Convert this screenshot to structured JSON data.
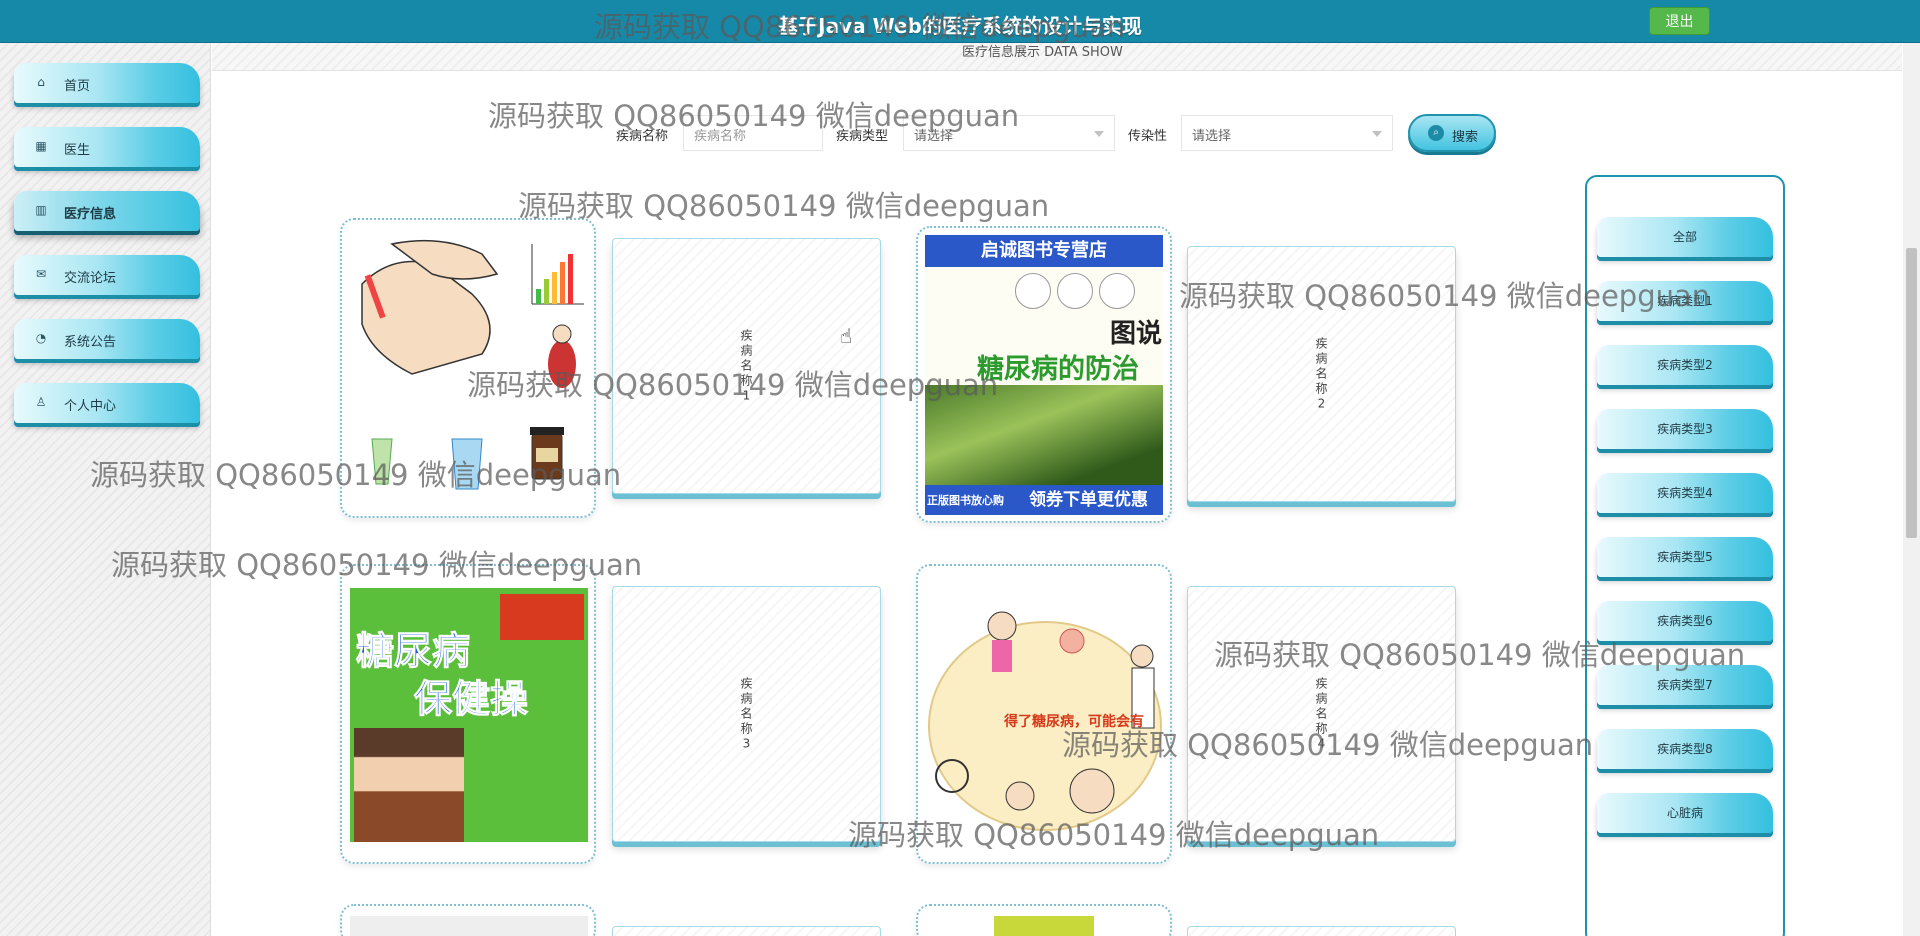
{
  "header": {
    "title": "基于Java Web的医疗系统的设计与实现",
    "logout_label": "退出"
  },
  "sidebar": {
    "items": [
      {
        "label": "首页",
        "icon": "home-icon"
      },
      {
        "label": "医生",
        "icon": "calendar-icon"
      },
      {
        "label": "医疗信息",
        "icon": "book-icon",
        "active": true
      },
      {
        "label": "交流论坛",
        "icon": "mail-icon"
      },
      {
        "label": "系统公告",
        "icon": "palette-icon"
      },
      {
        "label": "个人中心",
        "icon": "user-icon"
      }
    ]
  },
  "page": {
    "subtitle": "医疗信息展示 DATA SHOW"
  },
  "search": {
    "name_label": "疾病名称",
    "name_placeholder": "疾病名称",
    "type_label": "疾病类型",
    "type_value": "请选择",
    "infectious_label": "传染性",
    "infectious_value": "请选择",
    "button_label": "搜索"
  },
  "cards": {
    "c1": {
      "image": "diabetes-test-illustration"
    },
    "c2": {
      "label": "疾病名称1"
    },
    "c3": {
      "image": "diabetes-book-cover",
      "banner": "启诚图书专营店",
      "book_title": "图说",
      "book_sub": "糖尿病的防治",
      "promo_left": "正版图书放心购",
      "promo_right": "领券下单更优惠"
    },
    "c4": {
      "label": "疾病名称2"
    },
    "c5": {
      "image": "diabetes-exercise-book",
      "title1": "糖尿病",
      "title2": "保健操"
    },
    "c6": {
      "label": "疾病名称3"
    },
    "c7": {
      "image": "diabetes-complications-illustration",
      "caption": "得了糖尿病，可能会有"
    },
    "c8": {
      "label": "疾病名称4"
    }
  },
  "categories": {
    "items": [
      "全部",
      "疾病类型1",
      "疾病类型2",
      "疾病类型3",
      "疾病类型4",
      "疾病类型5",
      "疾病类型6",
      "疾病类型7",
      "疾病类型8",
      "心脏病"
    ]
  },
  "watermark": {
    "text": "源码获取 QQ86050149 微信deepguan",
    "header_text": "源码获取 QQ86050149 微信deepguan"
  },
  "colors": {
    "header_bg": "#1789a8",
    "accent_cyan": "#33c0df",
    "logout_green": "#54b84a"
  }
}
